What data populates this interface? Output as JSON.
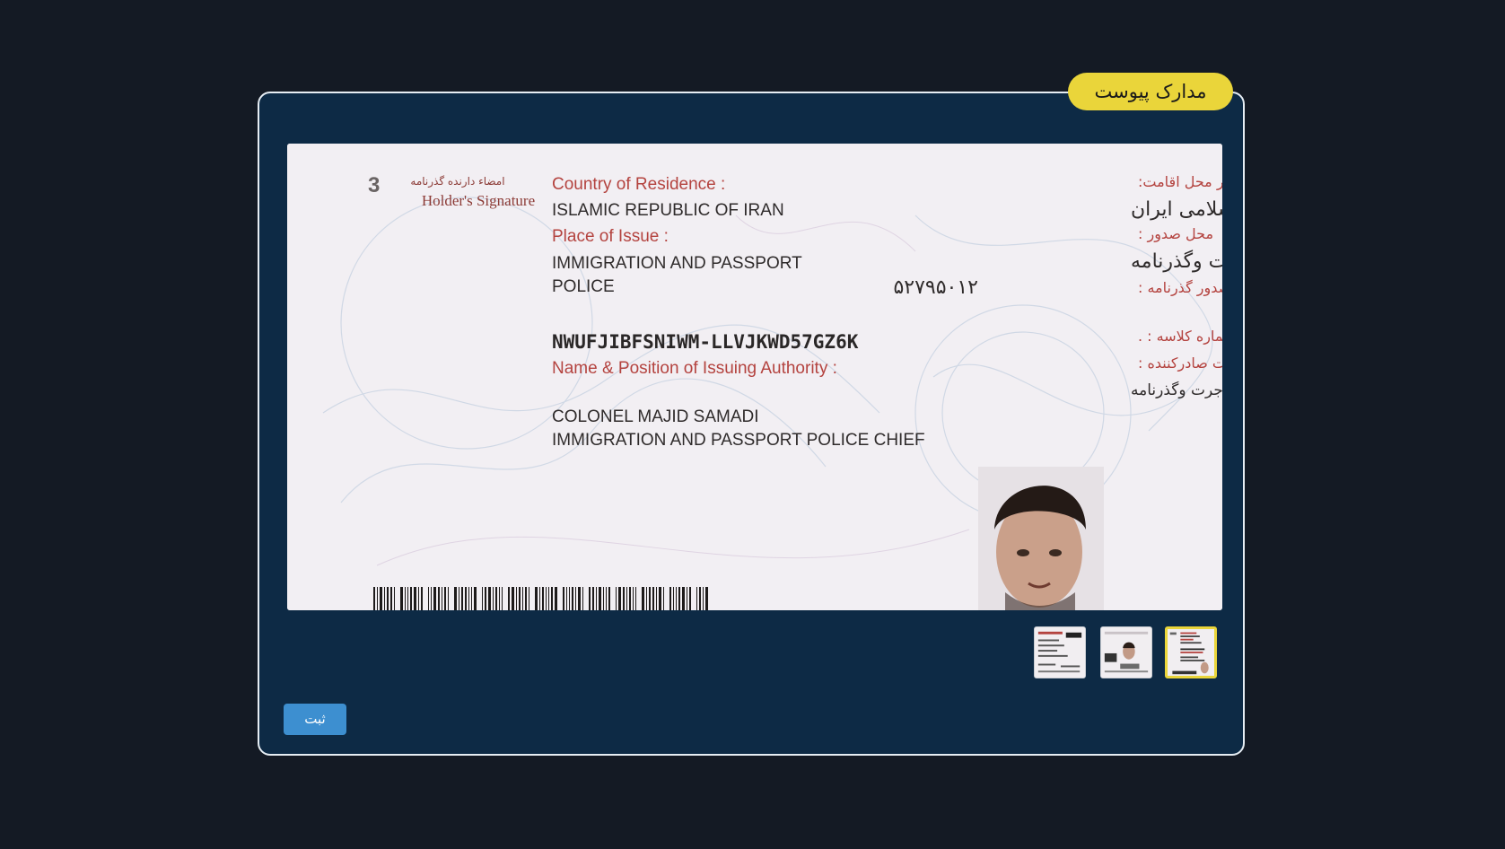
{
  "modal": {
    "title": "مدارک پیوست",
    "submit_label": "ثبت"
  },
  "document": {
    "page_number": "3",
    "signature_label_fa": "امضاء دارنده گذرنامه",
    "signature_label_en": "Holder's Signature",
    "country_label_en": "Country of Residence :",
    "country_label_fa": "کشور محل اقامت:",
    "country_value_en": "ISLAMIC REPUBLIC OF IRAN",
    "country_value_fa": "جمهوری اسلامی ایران",
    "place_label_en": "Place of Issue :",
    "place_label_fa": "محل صدور :",
    "place_value_en_line1": "IMMIGRATION  AND  PASSPORT",
    "place_value_en_line2": "POLICE",
    "place_value_fa": "پلیس مهاجرت وگذرنامه",
    "issue_doc_label_fa": "مدرک صدور گذرنامه :",
    "issue_doc_value": "۵۲۷۹۵۰۱۲",
    "class_number_label_fa": "شماره کلاسه : .",
    "class_number_value": "NWUFJIBFSNIWM-LLVJKWD57GZ6K",
    "authority_label_en": "Name & Position of Issuing Authority :",
    "authority_label_fa": "نام و سمت صادرکننده :",
    "authority_value_fa": "سرهنگ مجید صمدی -رئیس پلیس مهاجرت وگذرنامه",
    "authority_value_en_line1": "COLONEL MAJID SAMADI",
    "authority_value_en_line2": "IMMIGRATION  AND  PASSPORT  POLICE  CHIEF"
  },
  "thumbnails": [
    {
      "name": "attachment-1"
    },
    {
      "name": "attachment-2"
    },
    {
      "name": "attachment-3",
      "active": true
    }
  ],
  "colors": {
    "page_bg": "#141a24",
    "modal_bg": "#0d2a45",
    "accent_yellow": "#ead53a",
    "button_blue": "#3d8fd0",
    "doc_label_red": "#b4433f"
  }
}
